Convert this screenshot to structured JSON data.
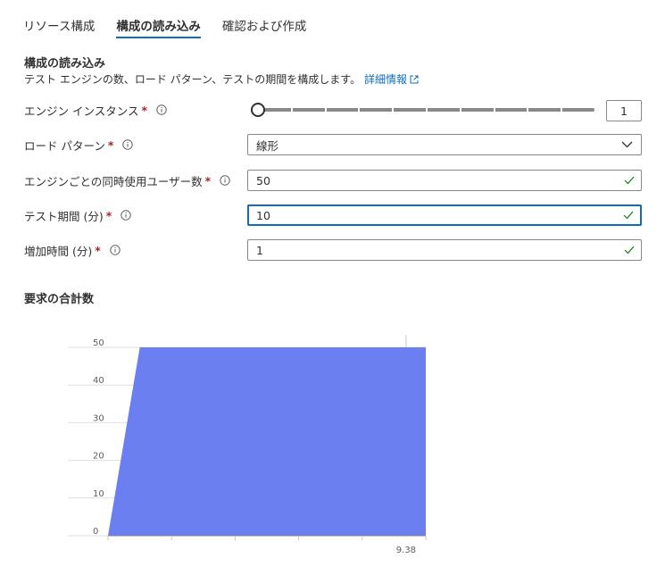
{
  "tabs": [
    {
      "label": "リソース構成",
      "active": false
    },
    {
      "label": "構成の読み込み",
      "active": true
    },
    {
      "label": "確認および作成",
      "active": false
    }
  ],
  "section": {
    "title": "構成の読み込み",
    "description": "テスト エンジンの数、ロード パターン、テストの期間を構成します。",
    "link_label": "詳細情報"
  },
  "fields": {
    "engine_instances": {
      "label": "エンジン インスタンス",
      "value": "1",
      "slider_level": 0
    },
    "load_pattern": {
      "label": "ロード パターン",
      "value": "線形"
    },
    "concurrent_users": {
      "label": "エンジンごとの同時使用ユーザー数",
      "value": "50"
    },
    "test_duration": {
      "label": "テスト期間 (分)",
      "value": "10"
    },
    "ramp_up": {
      "label": "増加時間 (分)",
      "value": "1"
    }
  },
  "required_marker": "*",
  "colors": {
    "accent": "#0f6cbd",
    "required": "#a4262c",
    "valid": "#107c10",
    "chart_fill": "#6b7ff0"
  },
  "chart_data": {
    "type": "area",
    "title": "要求の合計数",
    "x": [
      0,
      1,
      10
    ],
    "values": [
      0,
      50,
      50
    ],
    "xlim": [
      0,
      10
    ],
    "ylim": [
      0,
      50
    ],
    "y_ticks": [
      "0",
      "10",
      "20",
      "30",
      "40",
      "50"
    ],
    "x_ticks": [
      "9.38"
    ],
    "grid": true
  }
}
